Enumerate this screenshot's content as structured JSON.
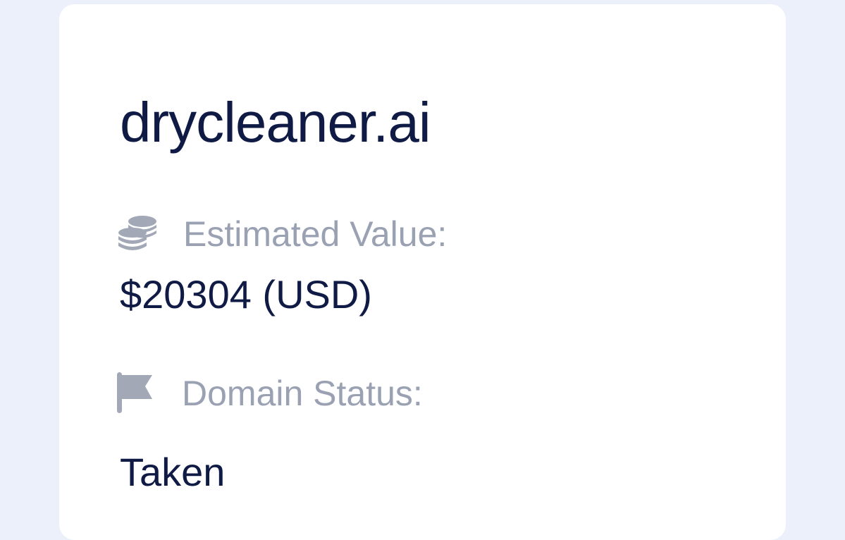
{
  "domain": {
    "name": "drycleaner.ai"
  },
  "estimated_value": {
    "label": "Estimated Value:",
    "value": "$20304 (USD)",
    "icon": "coins-icon"
  },
  "domain_status": {
    "label": "Domain Status:",
    "value": "Taken",
    "icon": "flag-icon"
  },
  "colors": {
    "background": "#ebf0fb",
    "card": "#ffffff",
    "primary_text": "#0f1a45",
    "muted_text": "#9aa1b2"
  }
}
